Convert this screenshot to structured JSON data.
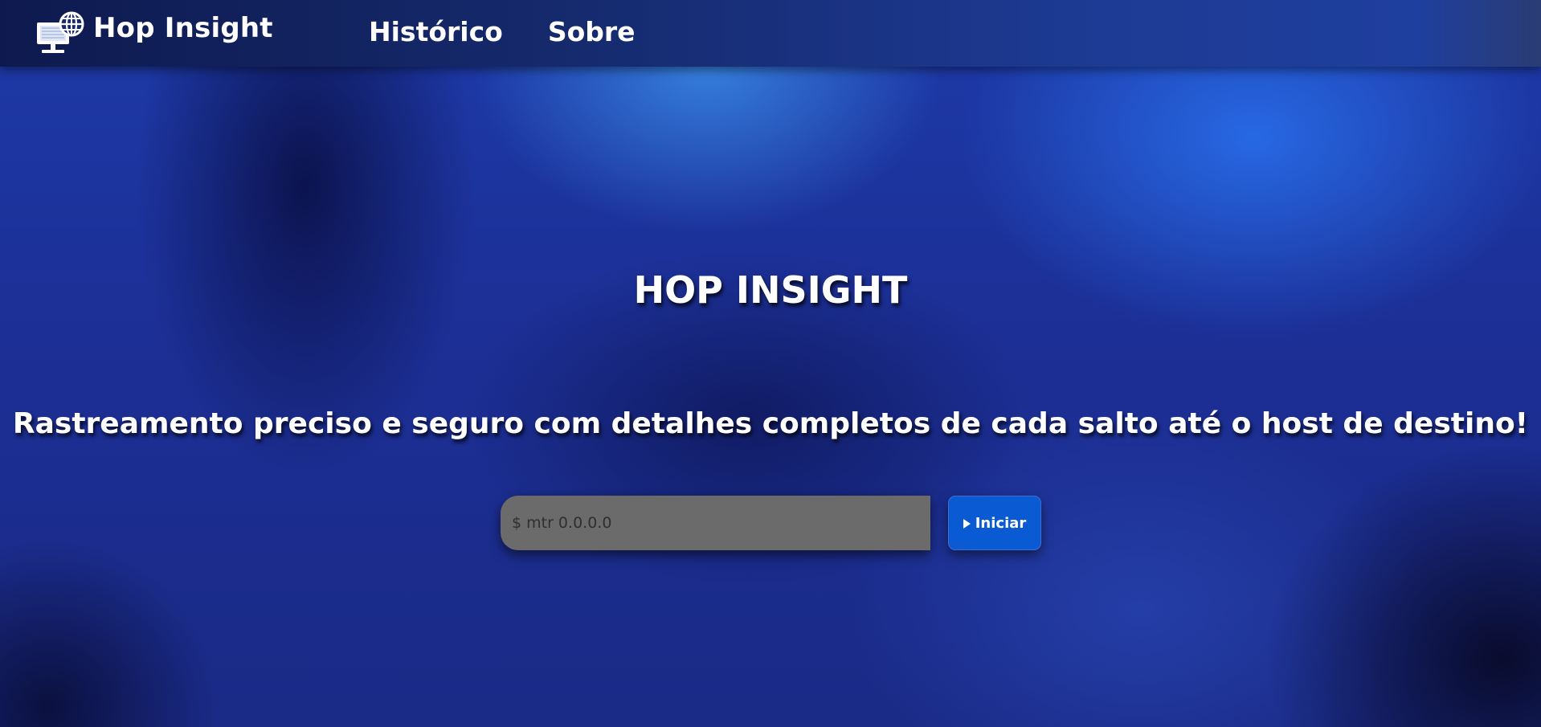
{
  "nav": {
    "brand_name": "Hop Insight",
    "links": [
      {
        "label": "Histórico"
      },
      {
        "label": "Sobre"
      }
    ]
  },
  "hero": {
    "title": "HOP INSIGHT",
    "subtitle": "Rastreamento preciso e seguro com detalhes completos de cada salto até o host de destino!"
  },
  "search": {
    "placeholder": "$ mtr 0.0.0.0",
    "value": ""
  },
  "start_button": {
    "label": "Iniciar",
    "icon": "play-icon"
  },
  "colors": {
    "accent": "#0a5ad3",
    "input_background": "#6b6b6b",
    "navbar": "#15296b",
    "background": "#1c2f96"
  },
  "icons": {
    "brand": "computer-globe-icon"
  }
}
